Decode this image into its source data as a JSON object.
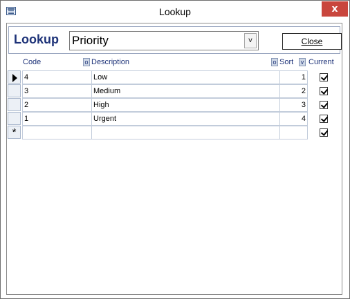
{
  "window": {
    "title": "Lookup",
    "close_glyph": "x"
  },
  "header": {
    "label": "Lookup",
    "combo_value": "Priority",
    "combo_button": "v",
    "close_label": "Close"
  },
  "columns": {
    "code": "Code",
    "code_sort": "o",
    "description": "Description",
    "description_sort": "o",
    "sort": "Sort",
    "sort_sort": "v",
    "current": "Current"
  },
  "rows": [
    {
      "code": "4",
      "description": "Low",
      "sort": "1",
      "current": true
    },
    {
      "code": "3",
      "description": "Medium",
      "sort": "2",
      "current": true
    },
    {
      "code": "2",
      "description": "High",
      "sort": "3",
      "current": true
    },
    {
      "code": "1",
      "description": "Urgent",
      "sort": "4",
      "current": true
    }
  ],
  "new_row": {
    "marker": "*",
    "current": true
  }
}
